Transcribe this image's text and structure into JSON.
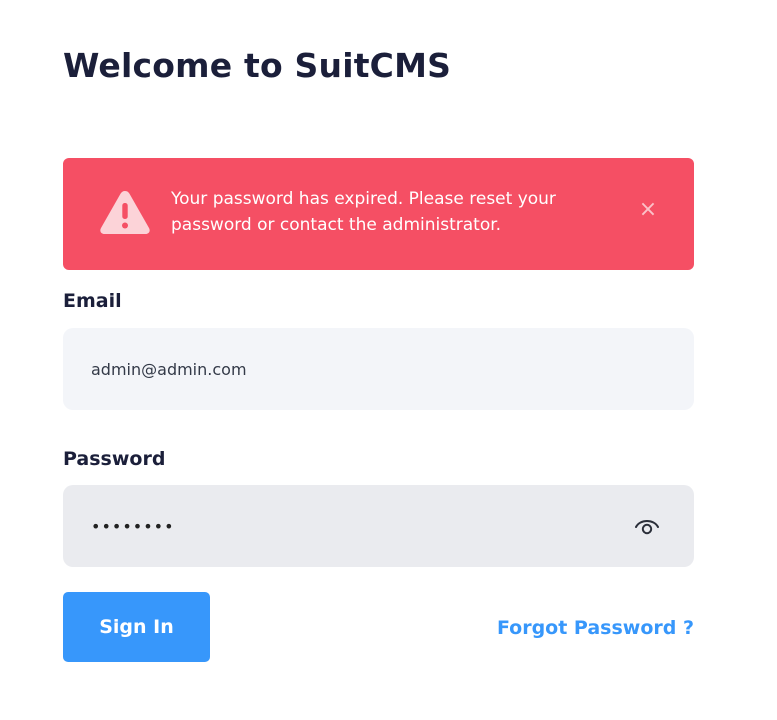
{
  "header": {
    "title": "Welcome to SuitCMS"
  },
  "alert": {
    "message": "Your password has expired. Please reset your password or contact the administrator.",
    "close_glyph": "×",
    "icon": "warning-triangle-icon",
    "color": "#f54f64"
  },
  "form": {
    "email_label": "Email",
    "email_value": "admin@admin.com",
    "password_label": "Password",
    "password_value": "12345678",
    "password_toggle_icon": "eye-icon"
  },
  "actions": {
    "signin_label": "Sign In",
    "forgot_label": "Forgot Password ?",
    "accent_color": "#3797fb"
  }
}
